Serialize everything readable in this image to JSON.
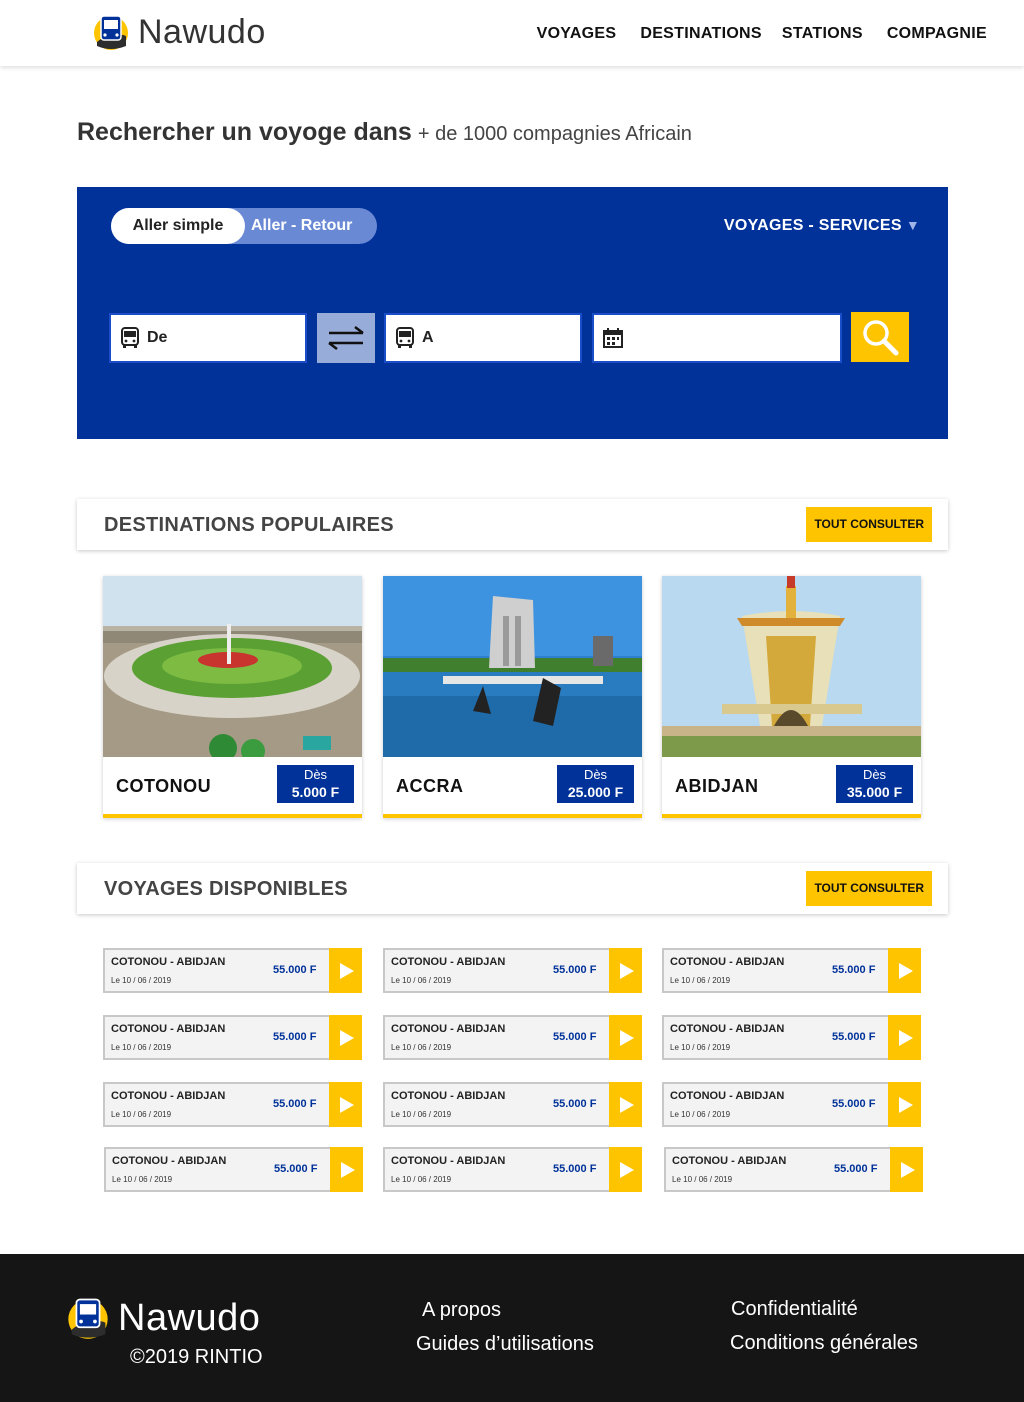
{
  "brand": {
    "name": "Nawudo",
    "accent": "#00329a",
    "highlight": "#fec400"
  },
  "nav": [
    {
      "label": "VOYAGES"
    },
    {
      "label": "DESTINATIONS"
    },
    {
      "label": "STATIONS"
    },
    {
      "label": "COMPAGNIE"
    }
  ],
  "hero": {
    "title_strong": "Rechercher un voyoge dans",
    "title_light": "+ de 1000 compagnies Africain"
  },
  "search": {
    "trip_types": [
      "Aller simple",
      "Aller - Retour"
    ],
    "selected_trip_type": "Aller simple",
    "services_label": "VOYAGES - SERVICES",
    "from_placeholder": "De",
    "to_placeholder": "A",
    "date_value": ""
  },
  "destinations": {
    "title": "DESTINATIONS POPULAIRES",
    "consult_label": "TOUT CONSULTER",
    "items": [
      {
        "name": "COTONOU",
        "from_label": "Dès",
        "price": "5.000 F"
      },
      {
        "name": "ACCRA",
        "from_label": "Dès",
        "price": "25.000 F"
      },
      {
        "name": "ABIDJAN",
        "from_label": "Dès",
        "price": "35.000 F"
      }
    ]
  },
  "trips": {
    "title": "VOYAGES DISPONIBLES",
    "consult_label": "TOUT CONSULTER",
    "items": [
      {
        "route": "COTONOU - ABIDJAN",
        "date": "Le 10 / 06 / 2019",
        "price": "55.000 F"
      },
      {
        "route": "COTONOU - ABIDJAN",
        "date": "Le 10 / 06 / 2019",
        "price": "55.000 F"
      },
      {
        "route": "COTONOU - ABIDJAN",
        "date": "Le 10 / 06 / 2019",
        "price": "55.000 F"
      },
      {
        "route": "COTONOU - ABIDJAN",
        "date": "Le 10 / 06 / 2019",
        "price": "55.000 F"
      },
      {
        "route": "COTONOU - ABIDJAN",
        "date": "Le 10 / 06 / 2019",
        "price": "55.000 F"
      },
      {
        "route": "COTONOU - ABIDJAN",
        "date": "Le 10 / 06 / 2019",
        "price": "55.000 F"
      },
      {
        "route": "COTONOU - ABIDJAN",
        "date": "Le 10 / 06 / 2019",
        "price": "55.000 F"
      },
      {
        "route": "COTONOU - ABIDJAN",
        "date": "Le 10 / 06 / 2019",
        "price": "55.000 F"
      },
      {
        "route": "COTONOU - ABIDJAN",
        "date": "Le 10 / 06 / 2019",
        "price": "55.000 F"
      },
      {
        "route": "COTONOU - ABIDJAN",
        "date": "Le 10 / 06 / 2019",
        "price": "55.000 F"
      },
      {
        "route": "COTONOU - ABIDJAN",
        "date": "Le 10 / 06 / 2019",
        "price": "55.000 F"
      },
      {
        "route": "COTONOU - ABIDJAN",
        "date": "Le 10 / 06 / 2019",
        "price": "55.000 F"
      }
    ]
  },
  "footer": {
    "brand": "Nawudo",
    "copyright": "©2019 RINTIO",
    "links": [
      "A propos",
      "Guides d’utilisations",
      "Confidentialité",
      "Conditions générales"
    ]
  }
}
